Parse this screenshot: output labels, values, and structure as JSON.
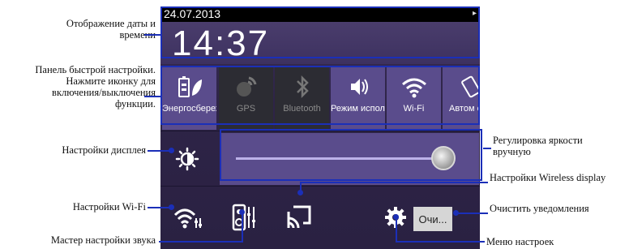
{
  "callouts": {
    "date_time": "Отображение даты и времени",
    "quick_settings": "Панель быстрой настройки. Нажмите иконку для включения/выключения функции.",
    "display_settings": "Настройки дисплея",
    "wifi_settings": "Настройки Wi-Fi",
    "sound_wizard": "Мастер настройки звука",
    "brightness": "Регулировка яркости вручную",
    "wireless_display": "Настройки Wireless display",
    "clear_notifications": "Очистить уведомления",
    "settings_menu": "Меню настроек"
  },
  "panel": {
    "date": "24.07.2013",
    "time": "14:37",
    "tiles": [
      {
        "label": "Энергосбережение",
        "icon": "battery-leaf-icon",
        "state": "on"
      },
      {
        "label": "GPS",
        "icon": "gps-icon",
        "state": "off"
      },
      {
        "label": "Bluetooth",
        "icon": "bluetooth-icon",
        "state": "off"
      },
      {
        "label": "Режим использова",
        "icon": "speaker-icon",
        "state": "on"
      },
      {
        "label": "Wi-Fi",
        "icon": "wifi-icon",
        "state": "on"
      },
      {
        "label": "Автом еск",
        "icon": "auto-rotate-icon",
        "state": "on"
      }
    ],
    "brightness_level": 0.95,
    "clear_button": "Очи..."
  },
  "colors": {
    "panel_bg": "#2b2042",
    "tile_on": "#5a4c8c",
    "tile_off": "#2c2c33",
    "frame_blue": "#1b2fb8"
  }
}
